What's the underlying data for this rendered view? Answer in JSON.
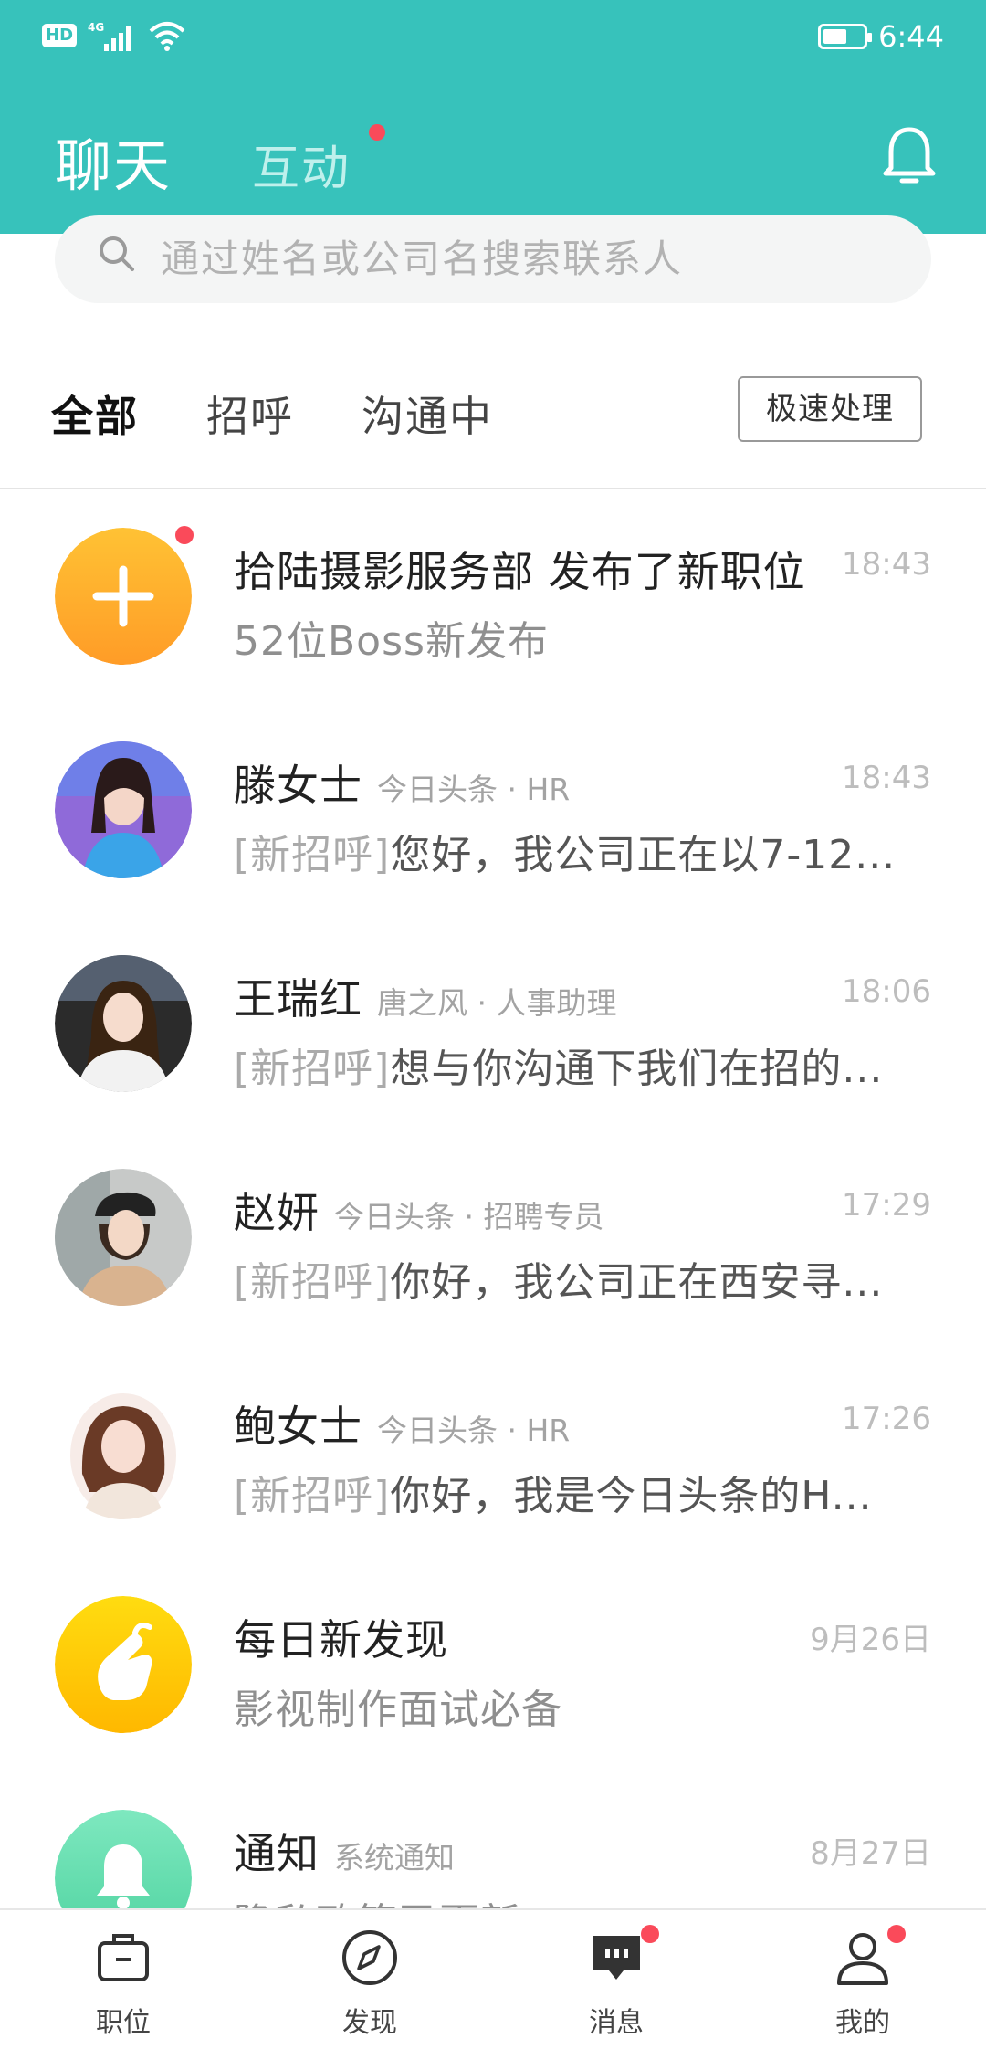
{
  "status_bar": {
    "hd_label": "HD",
    "network": "4G",
    "time": "6:44",
    "battery_percent": 60
  },
  "header": {
    "tab_chat": "聊天",
    "tab_interaction": "互动",
    "bell_icon": "bell-icon"
  },
  "search": {
    "placeholder": "通过姓名或公司名搜索联系人"
  },
  "filters": {
    "tabs": [
      "全部",
      "招呼",
      "沟通中"
    ],
    "active": "全部",
    "fast_button": "极速处理"
  },
  "chats": [
    {
      "name": "拾陆摄影服务部 发布了新职位",
      "subtitle": "",
      "time": "18:43",
      "tag": "",
      "message": "52位Boss新发布",
      "avatar": "plus-icon"
    },
    {
      "name": "滕女士",
      "subtitle": "今日头条 · HR",
      "time": "18:43",
      "tag": "[新招呼]",
      "message": "您好，我公司正在以7-12...",
      "avatar": "user-photo"
    },
    {
      "name": "王瑞红",
      "subtitle": "唐之风 · 人事助理",
      "time": "18:06",
      "tag": "[新招呼]",
      "message": "想与你沟通下我们在招的...",
      "avatar": "user-photo"
    },
    {
      "name": "赵妍",
      "subtitle": "今日头条 · 招聘专员",
      "time": "17:29",
      "tag": "[新招呼]",
      "message": "你好，我公司正在西安寻...",
      "avatar": "user-photo"
    },
    {
      "name": "鲍女士",
      "subtitle": "今日头条 · HR",
      "time": "17:26",
      "tag": "[新招呼]",
      "message": "你好，我是今日头条的H...",
      "avatar": "user-photo"
    },
    {
      "name": "每日新发现",
      "subtitle": "",
      "time": "9月26日",
      "tag": "",
      "message": "影视制作面试必备",
      "avatar": "finger-heart-icon"
    },
    {
      "name": "通知",
      "subtitle": "系统通知",
      "time": "8月27日",
      "tag": "",
      "message": "隐私政策已更新",
      "avatar": "bell-icon"
    }
  ],
  "bottom_nav": [
    {
      "label": "职位",
      "icon": "briefcase-icon"
    },
    {
      "label": "发现",
      "icon": "compass-icon"
    },
    {
      "label": "消息",
      "icon": "chat-bubble-icon"
    },
    {
      "label": "我的",
      "icon": "person-icon"
    }
  ],
  "colors": {
    "brand": "#37c2bb",
    "badge": "#fa4a5a",
    "orange": "#ffab2e",
    "yellow": "#ffcf0a",
    "mint": "#6fe0b2"
  }
}
